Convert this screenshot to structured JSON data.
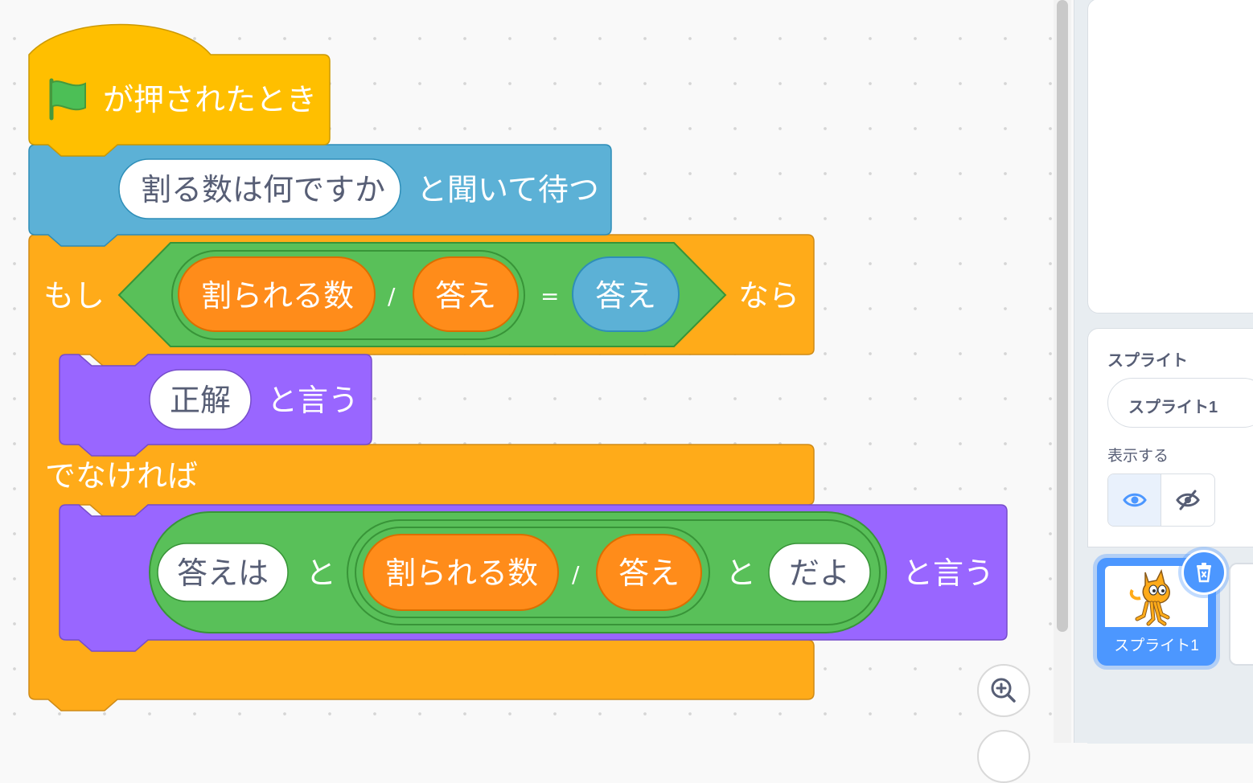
{
  "blocks": {
    "hat": {
      "label": "が押されたとき",
      "flag_icon": "green-flag-icon"
    },
    "ask": {
      "input": "割る数は何ですか",
      "suffix": "と聞いて待つ"
    },
    "if_else": {
      "if_label": "もし",
      "then_label": "なら",
      "else_label": "でなければ",
      "condition": {
        "left_var": "割られる数",
        "divide_op": "/",
        "right_var": "答え",
        "equals_op": "=",
        "compare_value": "答え"
      }
    },
    "say_correct": {
      "input": "正解",
      "suffix": "と言う"
    },
    "say_answer": {
      "join_1_text": "答えは",
      "join_word_1": "と",
      "div_left": "割られる数",
      "div_op": "/",
      "div_right": "答え",
      "join_word_2": "と",
      "join_2_text": "だよ",
      "suffix": "と言う"
    }
  },
  "colors": {
    "events": "#ffbf00",
    "sensing": "#5cb1d6",
    "control": "#ffab19",
    "looks": "#9966ff",
    "operators": "#59c059",
    "variables": "#ff8c1a",
    "accent": "#4c97ff"
  },
  "sprite_panel": {
    "sprite_label": "スプライト",
    "sprite_name": "スプライト1",
    "show_label": "表示する",
    "show_icon": "eye-icon",
    "hide_icon": "eye-slash-icon",
    "tile_name": "スプライト1",
    "delete_icon": "trash-icon"
  },
  "zoom": {
    "zoom_in_icon": "zoom-in-icon"
  }
}
